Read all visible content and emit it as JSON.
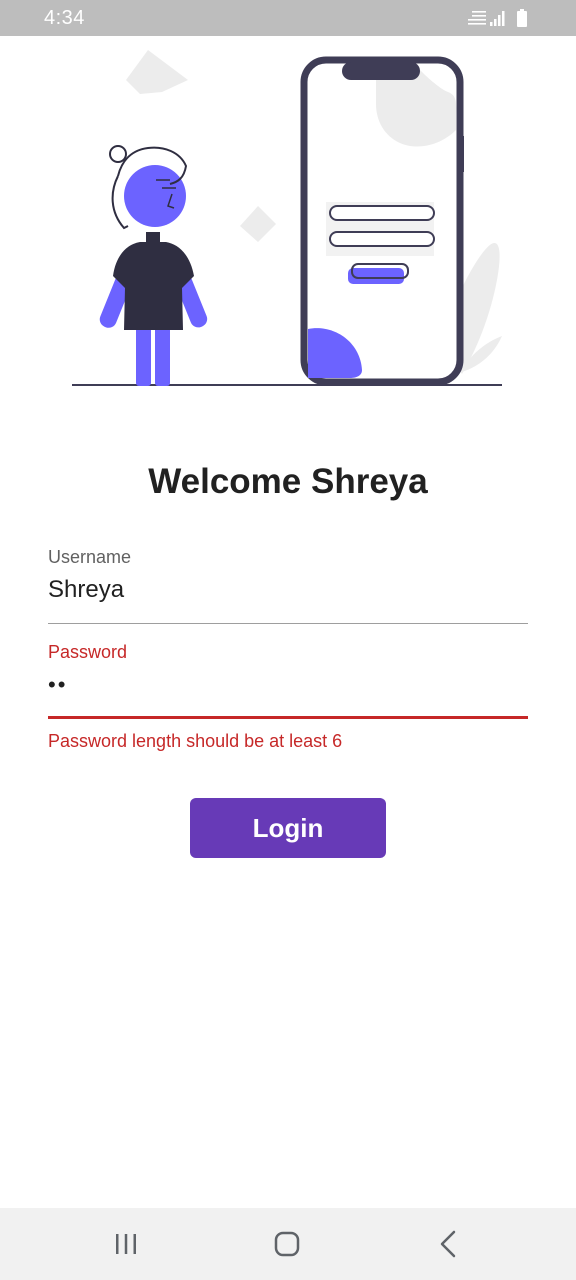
{
  "status_bar": {
    "time": "4:34",
    "icons": [
      "volte-lte-icon",
      "signal-icon",
      "battery-icon"
    ]
  },
  "illustration": {
    "icon": "person-with-phone-illustration",
    "accent_color": "#6c63ff",
    "dark_color": "#3f3d56"
  },
  "title": "Welcome Shreya",
  "form": {
    "username": {
      "label": "Username",
      "value": "Shreya"
    },
    "password": {
      "label": "Password",
      "value": "••",
      "error": "Password length should be at least 6",
      "error_color": "#c62828"
    }
  },
  "login_button": {
    "label": "Login",
    "color": "#673ab7"
  },
  "nav_bar": {
    "buttons": [
      "recent-apps-icon",
      "home-icon",
      "back-icon"
    ]
  }
}
